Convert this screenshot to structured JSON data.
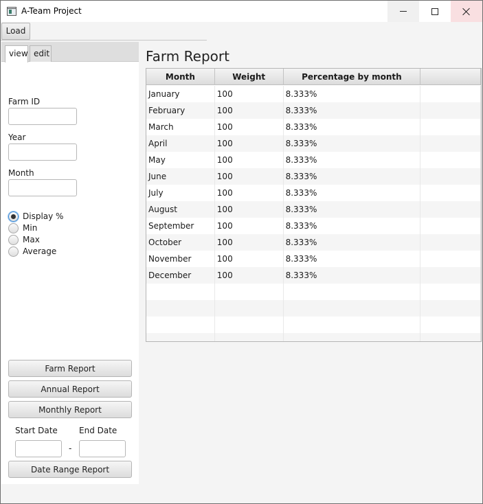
{
  "window": {
    "title": "A-Team Project"
  },
  "menubar": {
    "load_label": "Load"
  },
  "tabs": [
    {
      "label": "view"
    },
    {
      "label": "edit"
    }
  ],
  "form": {
    "farm_id_label": "Farm ID",
    "farm_id_value": "",
    "year_label": "Year",
    "year_value": "",
    "month_label": "Month",
    "month_value": ""
  },
  "radios": [
    {
      "label": "Display %",
      "selected": true
    },
    {
      "label": "Min",
      "selected": false
    },
    {
      "label": "Max",
      "selected": false
    },
    {
      "label": "Average",
      "selected": false
    }
  ],
  "buttons": {
    "farm_report": "Farm Report",
    "annual_report": "Annual Report",
    "monthly_report": "Monthly Report",
    "date_range_report": "Date Range Report"
  },
  "date_range": {
    "start_label": "Start Date",
    "end_label": "End Date",
    "separator": "-",
    "start_value": "",
    "end_value": ""
  },
  "report": {
    "title": "Farm Report",
    "columns": [
      "Month",
      "Weight",
      "Percentage by month",
      ""
    ],
    "rows": [
      [
        "January",
        "100",
        "8.333%"
      ],
      [
        "February",
        "100",
        "8.333%"
      ],
      [
        "March",
        "100",
        "8.333%"
      ],
      [
        "April",
        "100",
        "8.333%"
      ],
      [
        "May",
        "100",
        "8.333%"
      ],
      [
        "June",
        "100",
        "8.333%"
      ],
      [
        "July",
        "100",
        "8.333%"
      ],
      [
        "August",
        "100",
        "8.333%"
      ],
      [
        "September",
        "100",
        "8.333%"
      ],
      [
        "October",
        "100",
        "8.333%"
      ],
      [
        "November",
        "100",
        "8.333%"
      ],
      [
        "December",
        "100",
        "8.333%"
      ]
    ],
    "empty_rows": 4
  }
}
